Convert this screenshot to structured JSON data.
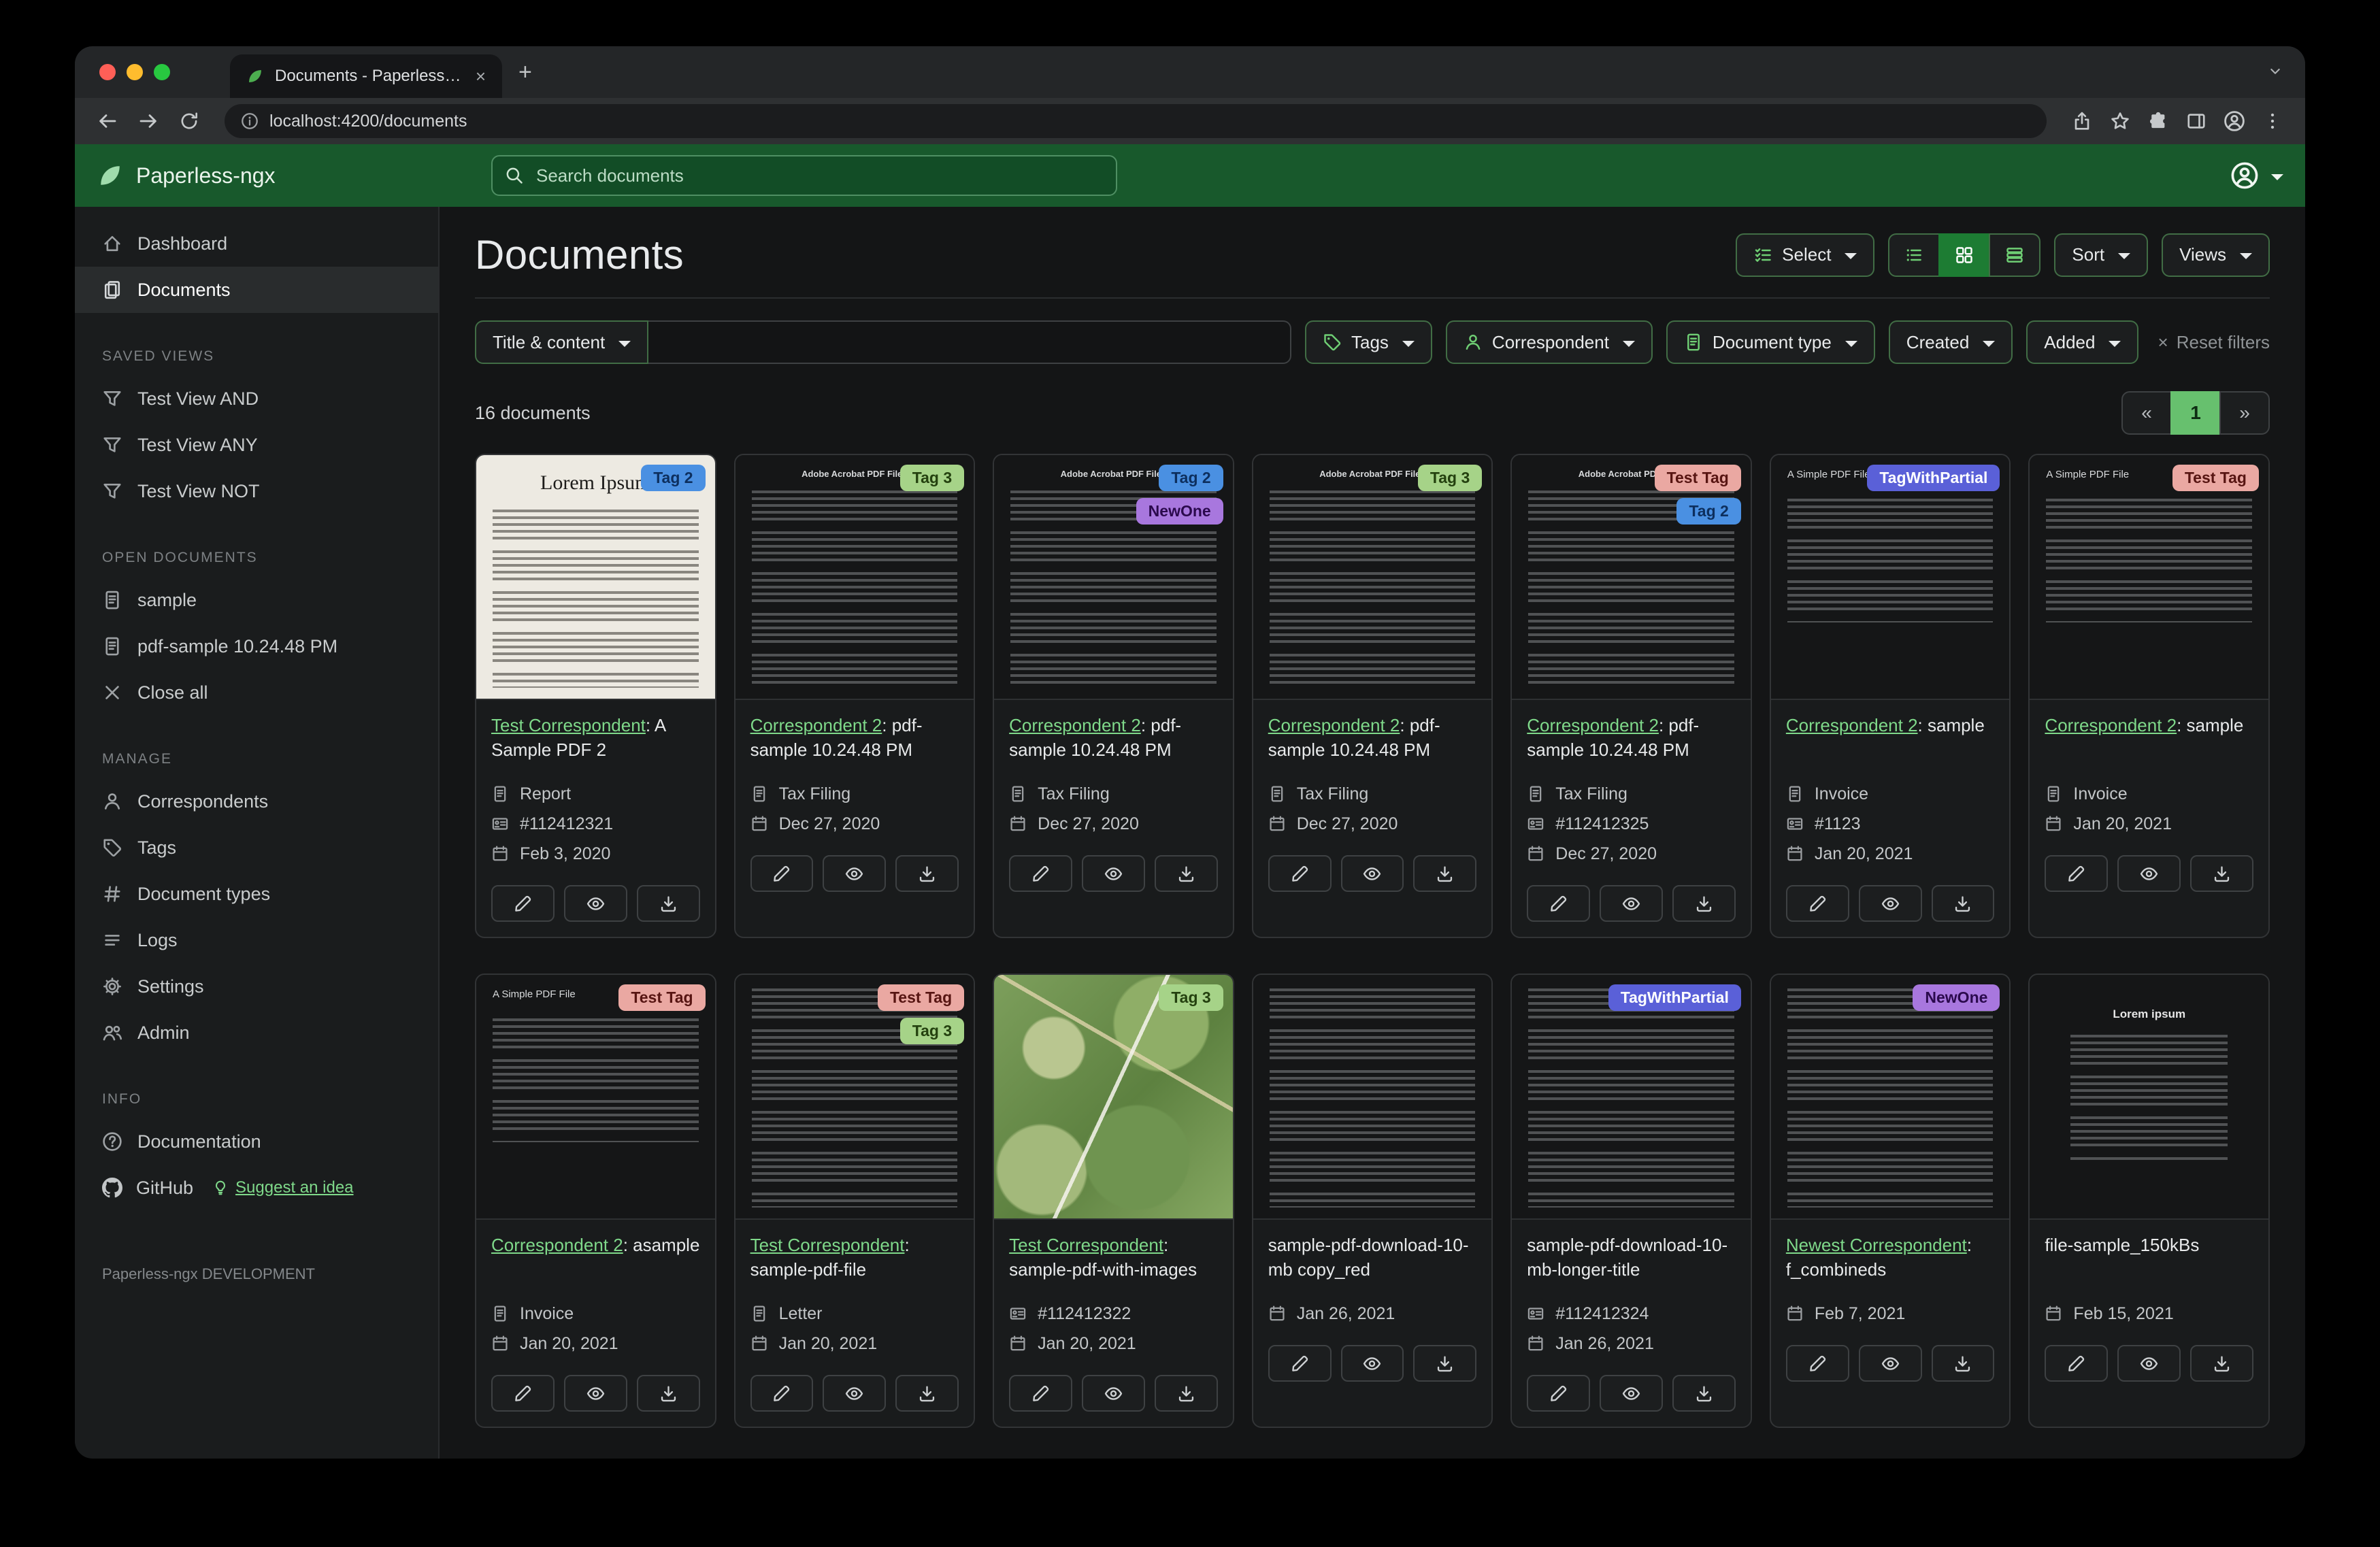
{
  "glyphs": {
    "close": "×",
    "plus": "+"
  },
  "browser": {
    "tab_title": "Documents - Paperless-ngx",
    "url": "localhost:4200/documents"
  },
  "navbar": {
    "brand": "Paperless-ngx",
    "search_placeholder": "Search documents"
  },
  "sidebar": {
    "dashboard": "Dashboard",
    "documents": "Documents",
    "saved_views_header": "SAVED VIEWS",
    "saved_views": [
      "Test View AND",
      "Test View ANY",
      "Test View NOT"
    ],
    "open_documents_header": "OPEN DOCUMENTS",
    "open_documents": [
      "sample",
      "pdf-sample 10.24.48 PM"
    ],
    "close_all": "Close all",
    "manage_header": "MANAGE",
    "manage": [
      "Correspondents",
      "Tags",
      "Document types",
      "Logs",
      "Settings",
      "Admin"
    ],
    "info_header": "INFO",
    "documentation": "Documentation",
    "github": "GitHub",
    "suggest_idea": "Suggest an idea",
    "footer": "Paperless-ngx DEVELOPMENT"
  },
  "header": {
    "title": "Documents",
    "select_label": "Select",
    "sort_label": "Sort",
    "views_label": "Views"
  },
  "filters": {
    "title_content_label": "Title & content",
    "query_value": "",
    "tags_label": "Tags",
    "correspondent_label": "Correspondent",
    "document_type_label": "Document type",
    "created_label": "Created",
    "added_label": "Added",
    "reset_label": "Reset filters"
  },
  "results": {
    "count_text": "16 documents",
    "pagination": {
      "prev": "«",
      "page": "1",
      "next": "»"
    }
  },
  "accent_colors": {
    "primary_green": "#18592c",
    "link_green": "#7fd98a"
  },
  "tag_styles": {
    "Tag 2": {
      "bg": "#4a90e2",
      "fg": "#0d2f5e"
    },
    "Tag 3": {
      "bg": "#a6d388",
      "fg": "#24410f"
    },
    "NewOne": {
      "bg": "#a877de",
      "fg": "#2b0a4d"
    },
    "Test Tag": {
      "bg": "#eaa8a2",
      "fg": "#571512"
    },
    "TagWithPartial": {
      "bg": "#5a60d8",
      "fg": "#ffffff"
    }
  },
  "card_actions": [
    {
      "name": "edit",
      "icon": "pencil"
    },
    {
      "name": "view",
      "icon": "eye"
    },
    {
      "name": "download",
      "icon": "download"
    }
  ],
  "cards": [
    {
      "tags": [
        "Tag 2"
      ],
      "thumb": {
        "variant": "light-serif",
        "heading": "Lorem Ipsum"
      },
      "link": "Test Correspondent",
      "suffix": ": A Sample PDF 2",
      "meta": [
        {
          "icon": "document-type",
          "text": "Report"
        },
        {
          "icon": "asn",
          "text": "#112412321"
        },
        {
          "icon": "date",
          "text": "Feb 3, 2020"
        }
      ]
    },
    {
      "tags": [
        "Tag 3"
      ],
      "thumb": {
        "variant": "dark-pdf",
        "heading": "Adobe Acrobat PDF Files"
      },
      "link": "Correspondent 2",
      "suffix": ": pdf-sample 10.24.48 PM",
      "meta": [
        {
          "icon": "document-type",
          "text": "Tax Filing"
        },
        {
          "icon": "date",
          "text": "Dec 27, 2020"
        }
      ]
    },
    {
      "tags": [
        "Tag 2",
        "NewOne"
      ],
      "thumb": {
        "variant": "dark-pdf",
        "heading": "Adobe Acrobat PDF Files"
      },
      "link": "Correspondent 2",
      "suffix": ": pdf-sample 10.24.48 PM",
      "meta": [
        {
          "icon": "document-type",
          "text": "Tax Filing"
        },
        {
          "icon": "date",
          "text": "Dec 27, 2020"
        }
      ]
    },
    {
      "tags": [
        "Tag 3"
      ],
      "thumb": {
        "variant": "dark-pdf",
        "heading": "Adobe Acrobat PDF Files"
      },
      "link": "Correspondent 2",
      "suffix": ": pdf-sample 10.24.48 PM",
      "meta": [
        {
          "icon": "document-type",
          "text": "Tax Filing"
        },
        {
          "icon": "date",
          "text": "Dec 27, 2020"
        }
      ]
    },
    {
      "tags": [
        "Test Tag",
        "Tag 2"
      ],
      "thumb": {
        "variant": "dark-pdf",
        "heading": "Adobe Acrobat PDF Files"
      },
      "link": "Correspondent 2",
      "suffix": ": pdf-sample 10.24.48 PM",
      "meta": [
        {
          "icon": "document-type",
          "text": "Tax Filing"
        },
        {
          "icon": "asn",
          "text": "#112412325"
        },
        {
          "icon": "date",
          "text": "Dec 27, 2020"
        }
      ]
    },
    {
      "tags": [
        "TagWithPartial"
      ],
      "thumb": {
        "variant": "dark-simple",
        "heading": "A Simple PDF File"
      },
      "link": "Correspondent 2",
      "suffix": ": sample",
      "meta": [
        {
          "icon": "document-type",
          "text": "Invoice"
        },
        {
          "icon": "asn",
          "text": "#1123"
        },
        {
          "icon": "date",
          "text": "Jan 20, 2021"
        }
      ]
    },
    {
      "tags": [
        "Test Tag"
      ],
      "thumb": {
        "variant": "dark-simple",
        "heading": "A Simple PDF File"
      },
      "link": "Correspondent 2",
      "suffix": ": sample",
      "meta": [
        {
          "icon": "document-type",
          "text": "Invoice"
        },
        {
          "icon": "date",
          "text": "Jan 20, 2021"
        }
      ]
    },
    {
      "tags": [
        "Test Tag"
      ],
      "thumb": {
        "variant": "dark-simple",
        "heading": "A Simple PDF File"
      },
      "link": "Correspondent 2",
      "suffix": ": asample",
      "meta": [
        {
          "icon": "document-type",
          "text": "Invoice"
        },
        {
          "icon": "date",
          "text": "Jan 20, 2021"
        }
      ]
    },
    {
      "tags": [
        "Test Tag",
        "Tag 3"
      ],
      "thumb": {
        "variant": "dark-dense",
        "heading": ""
      },
      "link": "Test Correspondent",
      "suffix": ": sample-pdf-file",
      "meta": [
        {
          "icon": "document-type",
          "text": "Letter"
        },
        {
          "icon": "date",
          "text": "Jan 20, 2021"
        }
      ]
    },
    {
      "tags": [
        "Tag 3"
      ],
      "thumb": {
        "variant": "map",
        "heading": ""
      },
      "link": "Test Correspondent",
      "suffix": ": sample-pdf-with-images",
      "meta": [
        {
          "icon": "asn",
          "text": "#112412322"
        },
        {
          "icon": "date",
          "text": "Jan 20, 2021"
        }
      ]
    },
    {
      "tags": [],
      "thumb": {
        "variant": "dark-dense",
        "heading": ""
      },
      "link": "",
      "suffix": "sample-pdf-download-10-mb copy_red",
      "meta": [
        {
          "icon": "date",
          "text": "Jan 26, 2021"
        }
      ]
    },
    {
      "tags": [
        "TagWithPartial"
      ],
      "thumb": {
        "variant": "dark-dense",
        "heading": ""
      },
      "link": "",
      "suffix": "sample-pdf-download-10-mb-longer-title",
      "meta": [
        {
          "icon": "asn",
          "text": "#112412324"
        },
        {
          "icon": "date",
          "text": "Jan 26, 2021"
        }
      ]
    },
    {
      "tags": [
        "NewOne"
      ],
      "thumb": {
        "variant": "dark-dense",
        "heading": ""
      },
      "link": "Newest Correspondent",
      "suffix": ": f_combineds",
      "meta": [
        {
          "icon": "date",
          "text": "Feb 7, 2021"
        }
      ]
    },
    {
      "tags": [],
      "thumb": {
        "variant": "dark-center",
        "heading": "Lorem ipsum"
      },
      "link": "",
      "suffix": "file-sample_150kBs",
      "meta": [
        {
          "icon": "date",
          "text": "Feb 15, 2021"
        }
      ]
    }
  ]
}
